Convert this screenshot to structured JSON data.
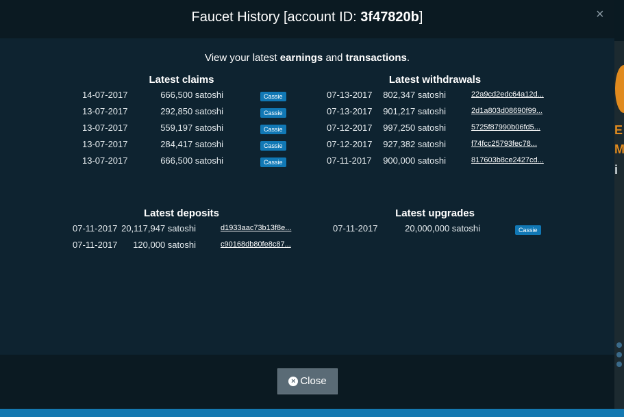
{
  "modal": {
    "title_prefix": "Faucet History [account ID: ",
    "account_id": "3f47820b",
    "title_suffix": "]",
    "close_x": "×",
    "intro": {
      "part1": "View your latest ",
      "earnings": "earnings",
      "part2": " and ",
      "transactions": "transactions",
      "part3": "."
    },
    "close_label": "Close"
  },
  "claims": {
    "title": "Latest claims",
    "rows": [
      {
        "date": "14-07-2017",
        "amount": "666,500 satoshi",
        "badge": "Cassie"
      },
      {
        "date": "13-07-2017",
        "amount": "292,850 satoshi",
        "badge": "Cassie"
      },
      {
        "date": "13-07-2017",
        "amount": "559,197 satoshi",
        "badge": "Cassie"
      },
      {
        "date": "13-07-2017",
        "amount": "284,417 satoshi",
        "badge": "Cassie"
      },
      {
        "date": "13-07-2017",
        "amount": "666,500 satoshi",
        "badge": "Cassie"
      }
    ]
  },
  "withdrawals": {
    "title": "Latest withdrawals",
    "rows": [
      {
        "date": "07-13-2017",
        "amount": "802,347 satoshi",
        "tx": "22a9cd2edc64a12d..."
      },
      {
        "date": "07-13-2017",
        "amount": "901,217 satoshi",
        "tx": "2d1a803d08690f99..."
      },
      {
        "date": "07-12-2017",
        "amount": "997,250 satoshi",
        "tx": "5725f87990b06fd5..."
      },
      {
        "date": "07-12-2017",
        "amount": "927,382 satoshi",
        "tx": "f74fcc25793fec78..."
      },
      {
        "date": "07-11-2017",
        "amount": "900,000 satoshi",
        "tx": "817603b8ce2427cd..."
      }
    ]
  },
  "deposits": {
    "title": "Latest deposits",
    "rows": [
      {
        "date": "07-11-2017",
        "amount": "20,117,947 satoshi",
        "tx": "d1933aac73b13f8e..."
      },
      {
        "date": "07-11-2017",
        "amount": "120,000 satoshi",
        "tx": "c90168db80fe8c87..."
      }
    ]
  },
  "upgrades": {
    "title": "Latest upgrades",
    "rows": [
      {
        "date": "07-11-2017",
        "amount": "20,000,000 satoshi",
        "badge": "Cassie"
      }
    ]
  },
  "colors": {
    "accent": "#1178b5",
    "modal_body": "#0e2330",
    "button": "#5a6b76"
  }
}
